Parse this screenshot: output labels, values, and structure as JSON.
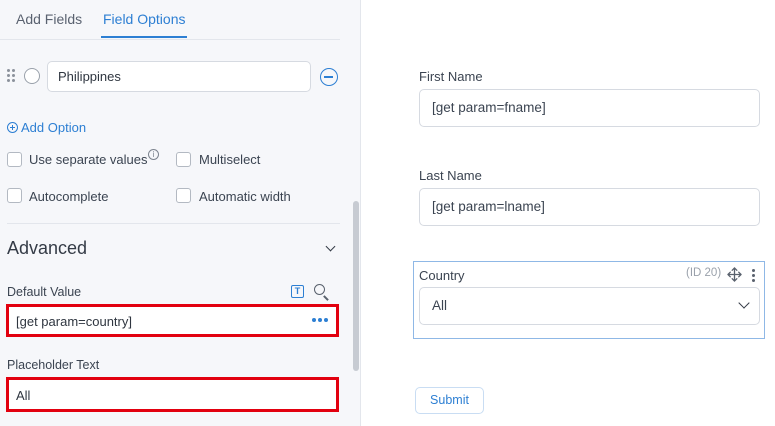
{
  "tabs": [
    {
      "label": "Add Fields",
      "active": false
    },
    {
      "label": "Field Options",
      "active": true
    }
  ],
  "option_row": {
    "value": "Philippines"
  },
  "add_option_label": "Add Option",
  "checkboxes": {
    "separate_values": "Use separate values",
    "multiselect": "Multiselect",
    "autocomplete": "Autocomplete",
    "automatic_width": "Automatic width"
  },
  "advanced": {
    "title": "Advanced",
    "default_value_label": "Default Value",
    "default_value": "[get param=country]",
    "placeholder_label": "Placeholder Text",
    "placeholder_value": "All"
  },
  "form": {
    "first_name_label": "First Name",
    "first_name_value": "[get param=fname]",
    "last_name_label": "Last Name",
    "last_name_value": "[get param=lname]",
    "country_label": "Country",
    "country_id": "(ID 20)",
    "country_value": "All",
    "submit_label": "Submit"
  },
  "colors": {
    "accent": "#2d7fd3",
    "highlight": "#e2000f",
    "panel_bg": "#f6f7fa"
  },
  "icons": [
    "drag-handle-icon",
    "radio-icon",
    "remove-circle-icon",
    "plus-circle-icon",
    "info-icon",
    "chevron-down-icon",
    "text-insert-icon",
    "search-icon",
    "more-dots-icon",
    "move-icon",
    "vertical-more-icon"
  ]
}
